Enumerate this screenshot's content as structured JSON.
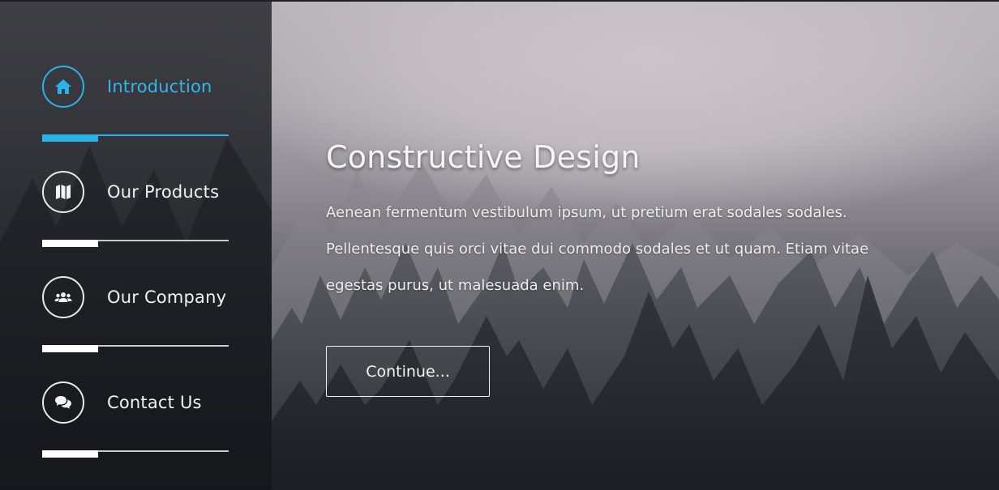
{
  "nav": {
    "items": [
      {
        "label": "Introduction",
        "icon": "home-icon",
        "active": true,
        "progress": 0.3
      },
      {
        "label": "Our Products",
        "icon": "map-icon",
        "active": false,
        "progress": 0.3
      },
      {
        "label": "Our Company",
        "icon": "users-icon",
        "active": false,
        "progress": 0.3
      },
      {
        "label": "Contact Us",
        "icon": "chat-icon",
        "active": false,
        "progress": 0.3
      }
    ]
  },
  "main": {
    "heading": "Constructive Design",
    "paragraph": "Aenean fermentum vestibulum ipsum, ut pretium erat sodales sodales. Pellentesque quis orci vitae dui commodo sodales et ut quam. Etiam vitae egestas purus, ut malesuada enim.",
    "button_label": "Continue..."
  },
  "colors": {
    "accent": "#2ab3e8",
    "sidebar_bg": "#1c1e23",
    "text": "#f2f2f2"
  }
}
